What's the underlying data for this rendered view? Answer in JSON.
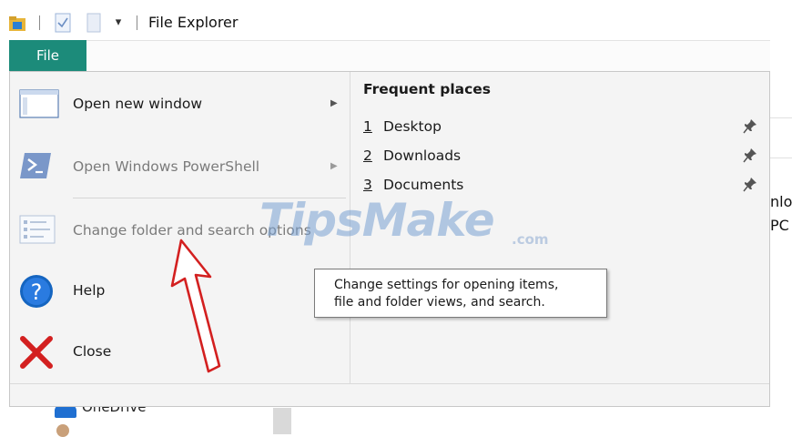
{
  "window": {
    "title": "File Explorer",
    "dropdown_glyph": "▾"
  },
  "ribbon": {
    "file_tab": "File"
  },
  "file_menu": {
    "items": [
      {
        "label": "Open new window",
        "underline": "n",
        "has_submenu": true,
        "enabled": true,
        "icon": "window-icon"
      },
      {
        "label": "Open Windows PowerShell",
        "underline": "S",
        "has_submenu": true,
        "enabled": false,
        "icon": "powershell-icon"
      },
      {
        "label": "Change folder and search options",
        "underline": "o",
        "has_submenu": false,
        "enabled": false,
        "icon": "folder-options-icon"
      },
      {
        "label": "Help",
        "underline": "H",
        "has_submenu": false,
        "enabled": true,
        "icon": "help-icon"
      },
      {
        "label": "Close",
        "underline": "C",
        "has_submenu": false,
        "enabled": true,
        "icon": "close-icon"
      }
    ],
    "submenu_arrow": "▶"
  },
  "frequent_places": {
    "title": "Frequent places",
    "items": [
      {
        "num": "1",
        "name": "Desktop"
      },
      {
        "num": "2",
        "name": "Downloads"
      },
      {
        "num": "3",
        "name": "Documents"
      }
    ]
  },
  "tooltip": {
    "line1": "Change settings for opening items,",
    "line2": "file and folder views, and search."
  },
  "background": {
    "peek1": "nlo",
    "peek2": "PC",
    "onedrive": "OneDrive"
  },
  "watermark": {
    "text": "TipsMake",
    "suffix": ".com"
  },
  "colors": {
    "file_tab": "#1c8b7a",
    "menu_bg": "#f4f4f4",
    "help_blue": "#1565c0",
    "close_red": "#d32020",
    "powershell_blue": "#2d5aa8"
  }
}
